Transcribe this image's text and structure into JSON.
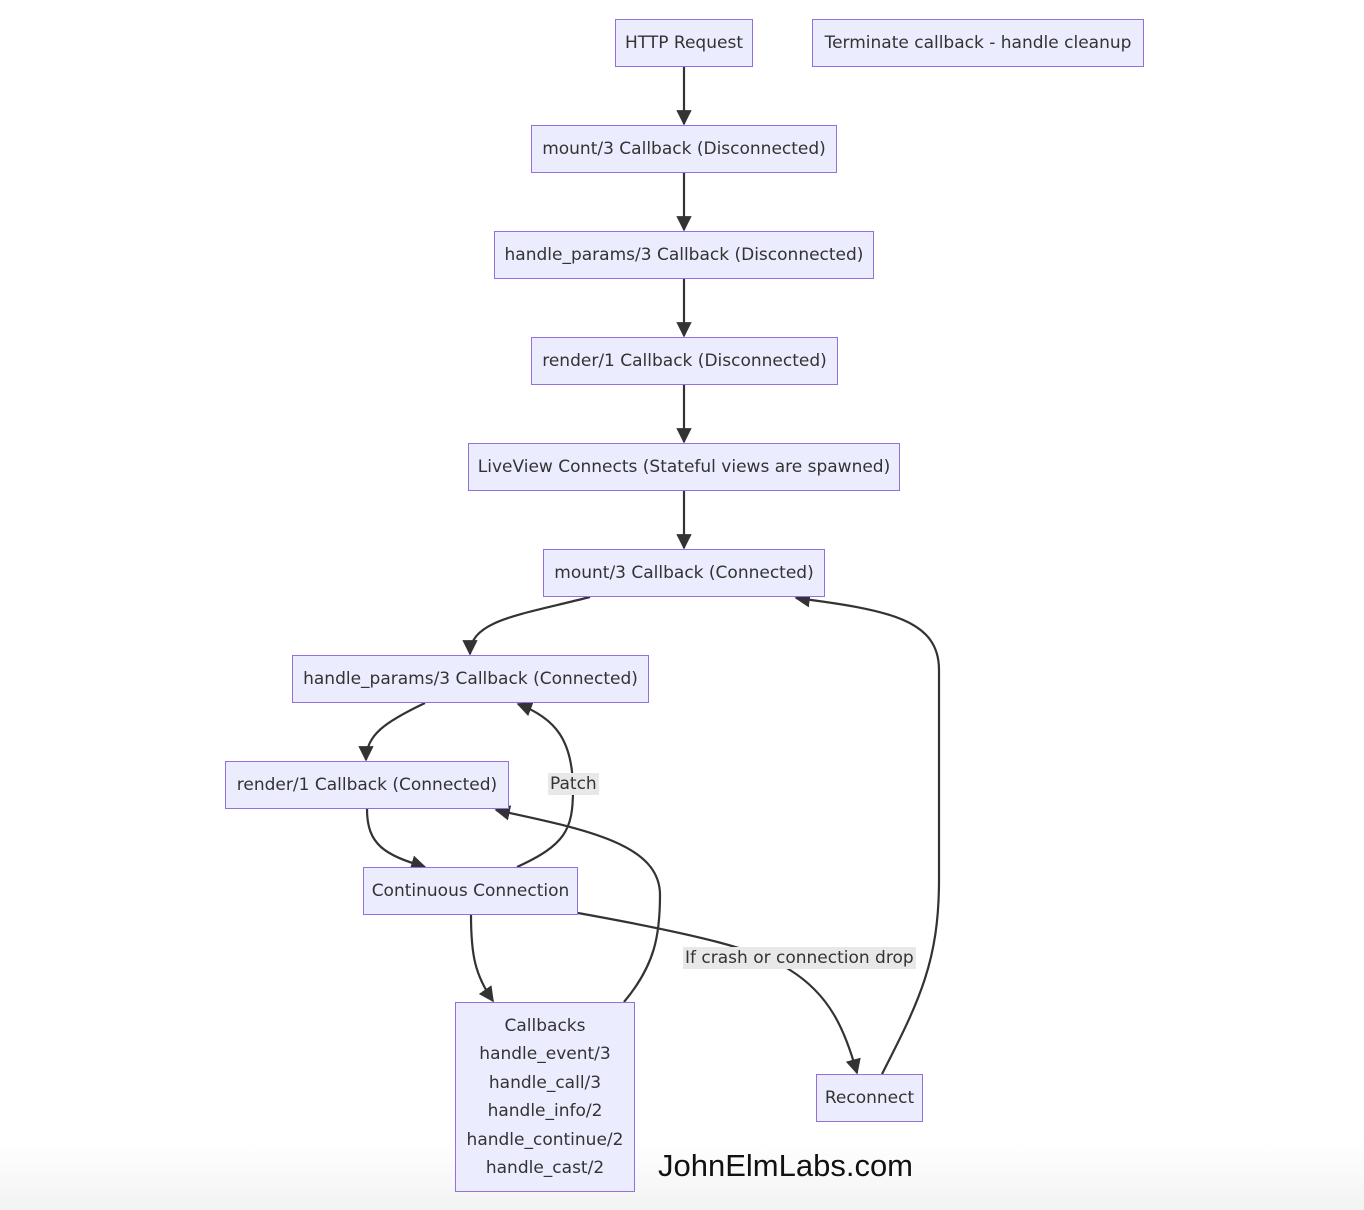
{
  "nodes": {
    "http_request": "HTTP Request",
    "terminate": "Terminate callback - handle cleanup",
    "mount_disconnected": "mount/3 Callback (Disconnected)",
    "handle_params_disconnected": "handle_params/3 Callback (Disconnected)",
    "render_disconnected": "render/1 Callback (Disconnected)",
    "liveview_connects": "LiveView Connects (Stateful views are spawned)",
    "mount_connected": "mount/3 Callback (Connected)",
    "handle_params_connected": "handle_params/3 Callback (Connected)",
    "render_connected": "render/1 Callback (Connected)",
    "continuous_connection": "Continuous Connection",
    "callbacks": [
      "Callbacks",
      "handle_event/3",
      "handle_call/3",
      "handle_info/2",
      "handle_continue/2",
      "handle_cast/2"
    ],
    "reconnect": "Reconnect"
  },
  "edge_labels": {
    "patch": "Patch",
    "crash": "If crash or connection drop"
  },
  "watermark": "JohnElmLabs.com",
  "colors": {
    "node_fill": "#ECECFF",
    "node_border": "#9370DB",
    "edge": "#333333",
    "label_bg": "#e8e8e8"
  }
}
